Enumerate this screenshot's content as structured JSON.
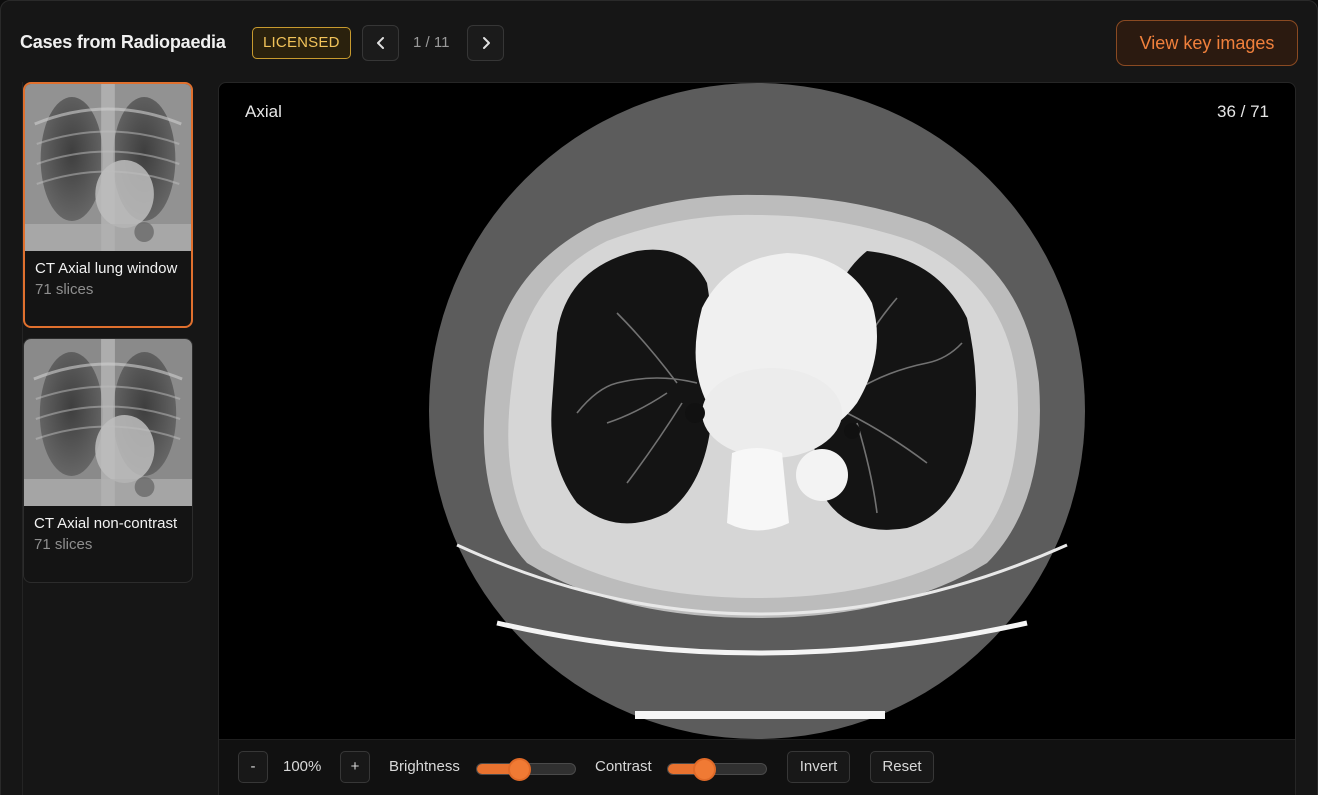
{
  "header": {
    "title": "Cases from Radiopaedia",
    "badge": "LICENSED",
    "counter": "1 / 11",
    "key_images_label": "View key images"
  },
  "series": [
    {
      "title": "CT Axial lung window",
      "slices": "71 slices",
      "active": true
    },
    {
      "title": "CT Axial non-contrast",
      "slices": "71 slices",
      "active": false
    }
  ],
  "viewer": {
    "orientation": "Axial",
    "slice_indicator": "36 / 71"
  },
  "toolbar": {
    "zoom_out": "-",
    "zoom": "100%",
    "zoom_in": "+",
    "brightness_label": "Brightness",
    "brightness_level": 0.43,
    "contrast_label": "Contrast",
    "contrast_level": 0.37,
    "invert": "Invert",
    "reset": "Reset"
  },
  "colors": {
    "accent": "#f07a34",
    "badge": "#f1c35a"
  }
}
